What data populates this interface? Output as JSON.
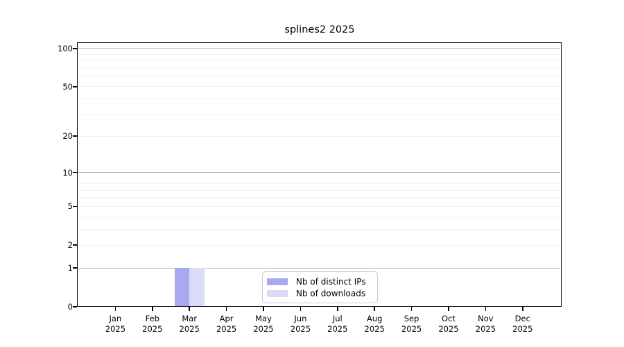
{
  "chart_data": {
    "type": "bar",
    "title": "splines2 2025",
    "categories": [
      "Jan",
      "Feb",
      "Mar",
      "Apr",
      "May",
      "Jun",
      "Jul",
      "Aug",
      "Sep",
      "Oct",
      "Nov",
      "Dec"
    ],
    "year_label": "2025",
    "series": [
      {
        "name": "Nb of distinct IPs",
        "color": "#a9a9f1",
        "values": [
          0,
          0,
          1,
          0,
          0,
          0,
          0,
          0,
          0,
          0,
          0,
          0
        ]
      },
      {
        "name": "Nb of downloads",
        "color": "#dbdbf9",
        "values": [
          0,
          0,
          1,
          0,
          0,
          0,
          0,
          0,
          0,
          0,
          0,
          0
        ]
      }
    ],
    "y_scale": "log1p",
    "ylim": [
      0,
      110
    ],
    "y_ticks": [
      0,
      1,
      2,
      5,
      10,
      20,
      50,
      100
    ],
    "grid": true,
    "grid_values_major": [
      1,
      10,
      100
    ],
    "grid_values_minor": [
      2,
      3,
      4,
      5,
      6,
      7,
      8,
      9,
      20,
      30,
      40,
      50,
      60,
      70,
      80,
      90
    ],
    "legend_position": "bottom-center",
    "xlabel": "",
    "ylabel": ""
  },
  "colors": {
    "background": "#ffffff",
    "spine": "#000000",
    "grid_major": "#bdbdbd",
    "grid_minor": "#f2f2f2",
    "legend_border": "#c9c9c9"
  }
}
